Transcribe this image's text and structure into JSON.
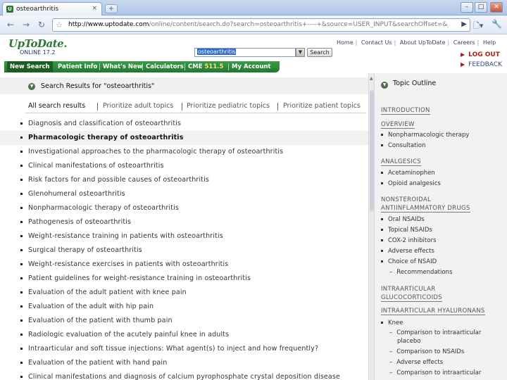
{
  "browser": {
    "tab_title": "osteoarthritis",
    "tab_close": "×",
    "new_tab": "+",
    "url_prefix": "http://www.uptodate.com",
    "url_path": "/online/content/search.do?search=osteoarthritis+----+&source=USER_INPUT&searchOffset=&_ND",
    "win_min": "–",
    "win_max": "□",
    "win_close": "✕"
  },
  "header": {
    "logo": "UpToDate.",
    "version": "ONLINE 17.2",
    "search_value": "osteoarthritis",
    "search_button": "Search",
    "top_links": [
      "Home",
      "Contact Us",
      "About UpToDate",
      "Careers",
      "Help"
    ],
    "logout": "LOG OUT",
    "feedback": "FEEDBACK"
  },
  "nav": {
    "items": [
      "New Search",
      "Patient Info",
      "What's New",
      "Calculators",
      "CME"
    ],
    "cme_value": "511.5",
    "account": "My Account"
  },
  "results": {
    "title": "Search Results for \"osteoarthritis\"",
    "filters": [
      "All search results",
      "Prioritize adult topics",
      "Prioritize pediatric topics",
      "Prioritize patient topics"
    ],
    "items": [
      "Diagnosis and classification of osteoarthritis",
      "Pharmacologic therapy of osteoarthritis",
      "Investigational approaches to the pharmacologic therapy of osteoarthritis",
      "Clinical manifestations of osteoarthritis",
      "Risk factors for and possible causes of osteoarthritis",
      "Glenohumeral osteoarthritis",
      "Nonpharmacologic therapy of osteoarthritis",
      "Pathogenesis of osteoarthritis",
      "Weight-resistance training in patients with osteoarthritis",
      "Surgical therapy of osteoarthritis",
      "Weight-resistance exercises in patients with osteoarthritis",
      "Patient guidelines for weight-resistance training in osteoarthritis",
      "Evaluation of the adult patient with knee pain",
      "Evaluation of the adult with hip pain",
      "Evaluation of the patient with thumb pain",
      "Radiologic evaluation of the acutely painful knee in adults",
      "Intraarticular and soft tissue injections: What agent(s) to inject and how frequently?",
      "Evaluation of the patient with hand pain",
      "Clinical manifestations and diagnosis of calcium pyrophosphate crystal deposition disease"
    ]
  },
  "outline": {
    "title": "Topic Outline",
    "introduction": "INTRODUCTION",
    "overview": "OVERVIEW",
    "overview_items": [
      "Nonpharmacologic therapy",
      "Consultation"
    ],
    "analgesics": "ANALGESICS",
    "analgesic_items": [
      "Acetaminophen",
      "Opioid analgesics"
    ],
    "nsaid_heading_1": "NONSTEROIDAL",
    "nsaid_heading_2": "ANTIINFLAMMATORY DRUGS",
    "nsaid_items": [
      "Oral NSAIDs",
      "Topical NSAIDs",
      "COX-2 inhibitors",
      "Adverse effects",
      "Choice of NSAID"
    ],
    "nsaid_sub": "Recommendations",
    "glucocorticoid_1": "INTRAARTICULAR",
    "glucocorticoid_2": "GLUCOCORTICOIDS",
    "hyaluronans": "INTRAARTICULAR HYALURONANS",
    "knee": "Knee",
    "knee_sub": [
      "Comparison to intraarticular",
      "placebo",
      "Comparison to NSAIDs",
      "Adverse effects",
      "Comparison to intraarticular"
    ]
  }
}
